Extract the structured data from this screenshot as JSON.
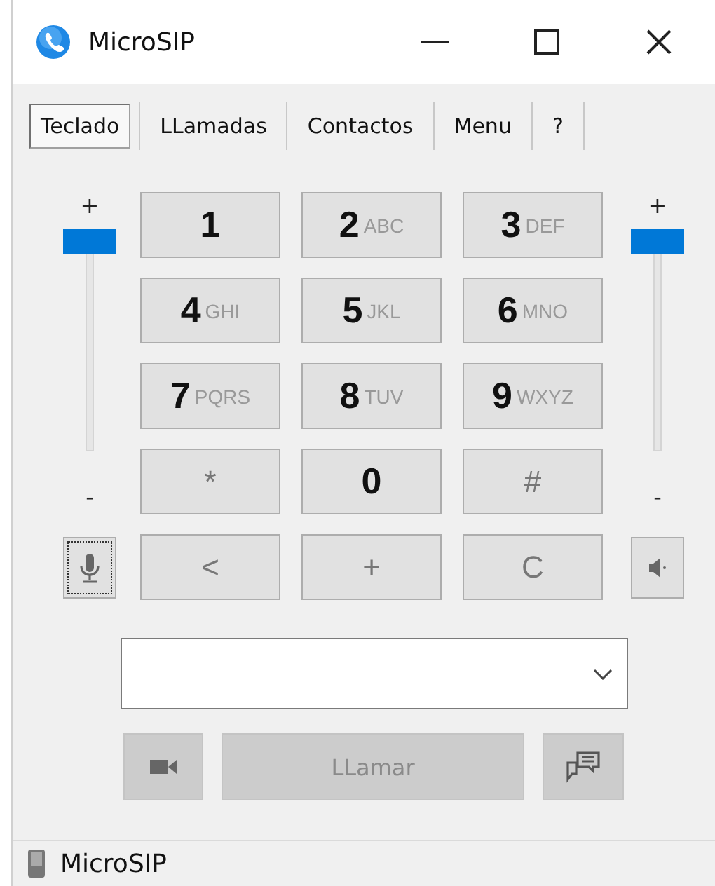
{
  "window": {
    "title": "MicroSIP"
  },
  "tabs": [
    {
      "label": "Teclado",
      "selected": true
    },
    {
      "label": "LLamadas",
      "selected": false
    },
    {
      "label": "Contactos",
      "selected": false
    },
    {
      "label": "Menu",
      "selected": false
    },
    {
      "label": "?",
      "selected": false
    }
  ],
  "microphone": {
    "plus": "+",
    "minus": "-",
    "level": 1,
    "muted": false
  },
  "speaker": {
    "plus": "+",
    "minus": "-",
    "level": 1,
    "muted": false
  },
  "keys": [
    {
      "kind": "digit",
      "main": "1"
    },
    {
      "kind": "digit",
      "main": "2",
      "letters": "ABC"
    },
    {
      "kind": "digit",
      "main": "3",
      "letters": "DEF"
    },
    {
      "kind": "digit",
      "main": "4",
      "letters": "GHI"
    },
    {
      "kind": "digit",
      "main": "5",
      "letters": "JKL"
    },
    {
      "kind": "digit",
      "main": "6",
      "letters": "MNO"
    },
    {
      "kind": "digit",
      "main": "7",
      "letters": "PQRS"
    },
    {
      "kind": "digit",
      "main": "8",
      "letters": "TUV"
    },
    {
      "kind": "digit",
      "main": "9",
      "letters": "WXYZ"
    },
    {
      "kind": "symbol",
      "main": "*"
    },
    {
      "kind": "digit",
      "main": "0"
    },
    {
      "kind": "symbol",
      "main": "#"
    },
    {
      "kind": "symbol",
      "main": "<"
    },
    {
      "kind": "symbol",
      "main": "+"
    },
    {
      "kind": "symbol",
      "main": "C"
    }
  ],
  "call": {
    "label": "LLamar",
    "disabled": true
  },
  "status_bar": {
    "text": "MicroSIP"
  }
}
